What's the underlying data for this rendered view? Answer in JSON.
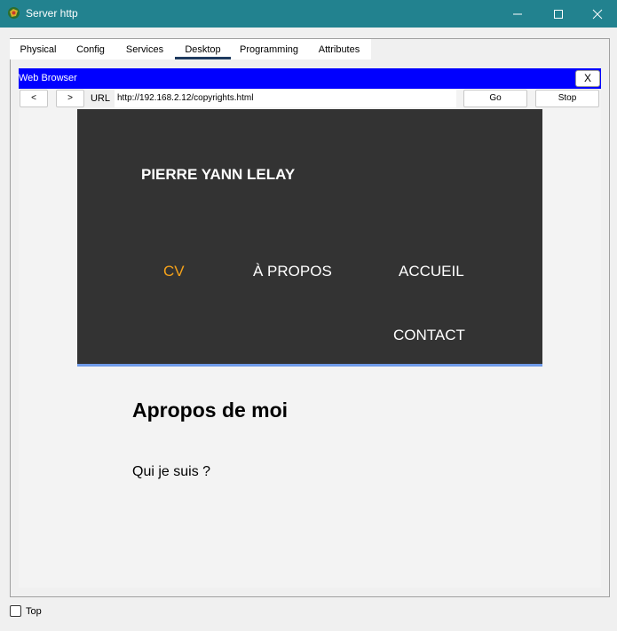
{
  "window": {
    "title": "Server http"
  },
  "tabs": [
    {
      "label": "Physical"
    },
    {
      "label": "Config"
    },
    {
      "label": "Services"
    },
    {
      "label": "Desktop"
    },
    {
      "label": "Programming"
    },
    {
      "label": "Attributes"
    }
  ],
  "browser": {
    "title": "Web Browser",
    "close_label": "X",
    "back_label": "<",
    "forward_label": ">",
    "url_label": "URL",
    "url_value": "http://192.168.2.12/copyrights.html",
    "go_label": "Go",
    "stop_label": "Stop"
  },
  "site": {
    "name": "PIERRE YANN LELAY",
    "nav": {
      "cv": "CV",
      "apropos": "À PROPOS",
      "accueil": "ACCUEIL",
      "contact": "CONTACT"
    },
    "about_title": "Apropos de moi",
    "about_subtitle": "Qui je suis ?"
  },
  "footer": {
    "top_label": "Top"
  },
  "colors": {
    "titlebar": "#22828f",
    "browser_bar": "#0000ff",
    "header_bg": "#333333",
    "active_nav": "#f5a21a",
    "header_border": "#6f9ae8"
  }
}
